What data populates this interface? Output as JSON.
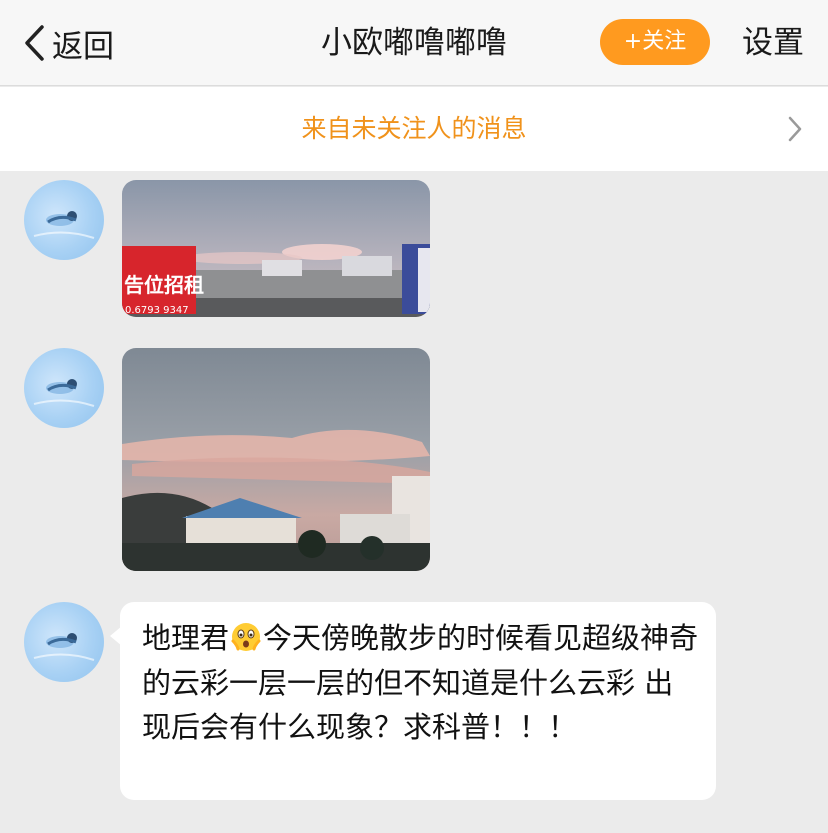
{
  "navbar": {
    "back_label": "返回",
    "title": "小欧嘟噜嘟噜",
    "follow_label": "+关注",
    "settings_label": "设置"
  },
  "banner": {
    "text": "来自未关注人的消息"
  },
  "messages": [
    {
      "type": "image",
      "sign_text": "告位招租",
      "sign_phone": "0.6793 9347",
      "icon": "photo-street-evening-clouds"
    },
    {
      "type": "image",
      "icon": "photo-lenticular-clouds-houses"
    },
    {
      "type": "text",
      "part1": "地理君",
      "emoji": "scared-face-emoji",
      "part2": "今天傍晚散步的时候看见超级神奇的云彩一层一层的但不知道是什么云彩 出现后会有什么现象？求科普！！！"
    }
  ],
  "colors": {
    "accent": "#ff9a1f",
    "banner_text": "#f0921b",
    "background": "#ebebeb"
  }
}
